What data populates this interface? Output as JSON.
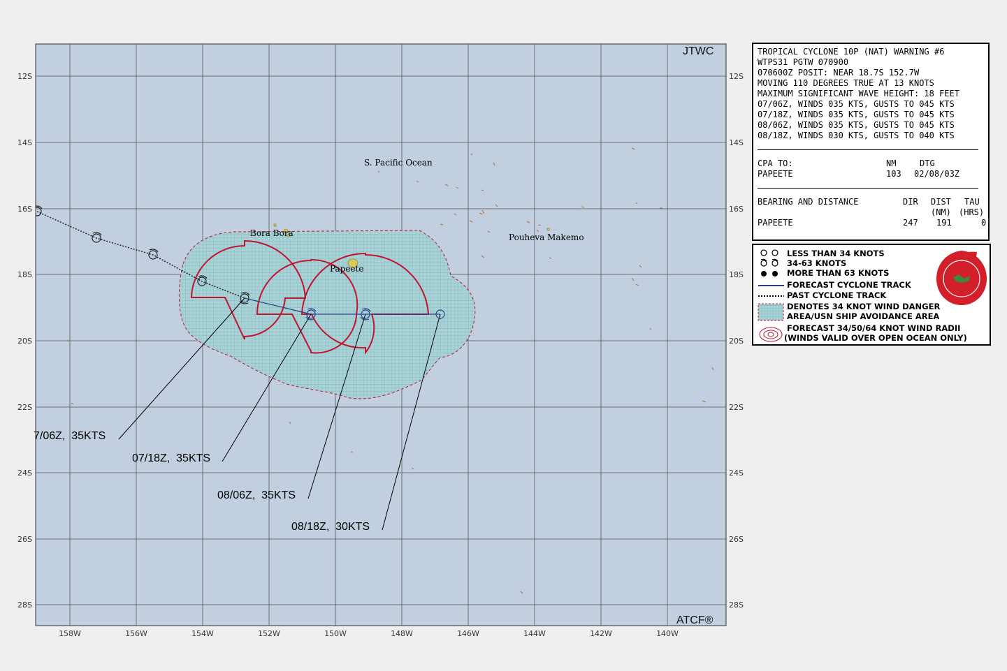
{
  "header": {
    "agency": "JTWC",
    "footer_mark": "ATCF®"
  },
  "map": {
    "lon_range": [
      -159,
      -148.6
    ],
    "lat_range": [
      -29.6,
      -11.1
    ],
    "lon_ticks": [
      "158W",
      "156W",
      "154W",
      "152W",
      "150W",
      "148W",
      "146W",
      "144W",
      "142W",
      "140W"
    ],
    "lat_ticks": [
      "12S",
      "14S",
      "16S",
      "18S",
      "20S",
      "22S",
      "24S",
      "26S",
      "28S"
    ],
    "places": [
      {
        "name": "S. Pacific Ocean"
      },
      {
        "name": "Bora Bora"
      },
      {
        "name": "Papeete"
      },
      {
        "name": "Pouheva Makemo"
      }
    ],
    "forecast_tags": [
      {
        "text": "7/06Z,  35KTS"
      },
      {
        "text": "07/18Z,  35KTS"
      },
      {
        "text": "08/06Z,  35KTS"
      },
      {
        "text": "08/18Z,  30KTS"
      }
    ]
  },
  "warning": {
    "lines": [
      "TROPICAL CYCLONE 10P (NAT) WARNING #6",
      "WTPS31 PGTW 070900",
      "070600Z POSIT: NEAR 18.7S 152.7W",
      "MOVING 110 DEGREES TRUE AT 13 KNOTS",
      "MAXIMUM SIGNIFICANT WAVE HEIGHT: 18 FEET",
      "07/06Z, WINDS 035 KTS, GUSTS TO 045 KTS",
      "07/18Z, WINDS 035 KTS, GUSTS TO 045 KTS",
      "08/06Z, WINDS 035 KTS, GUSTS TO 045 KTS",
      "08/18Z, WINDS 030 KTS, GUSTS TO 040 KTS"
    ],
    "cpa_label": "CPA TO:",
    "cpa_nm_header": "NM",
    "cpa_dtg_header": "DTG",
    "cpa_place": "PAPEETE",
    "cpa_nm": "103",
    "cpa_dtg": "02/08/03Z",
    "bd_label": "BEARING AND DISTANCE",
    "bd_dir_header": "DIR",
    "bd_dist_header": "DIST",
    "bd_tau_header": "TAU",
    "bd_nm_header": "(NM)",
    "bd_hrs_header": "(HRS)",
    "bd_place": "PAPEETE",
    "bd_dir": "247",
    "bd_dist": "191",
    "bd_tau": "0"
  },
  "legend": {
    "items": [
      "LESS THAN 34 KNOTS",
      "34-63 KNOTS",
      "MORE THAN 63 KNOTS",
      "FORECAST CYCLONE TRACK",
      "PAST CYCLONE TRACK",
      "DENOTES 34 KNOT WIND DANGER",
      "AREA/USN SHIP AVOIDANCE AREA",
      "FORECAST 34/50/64 KNOT WIND RADII",
      "(WINDS VALID OVER OPEN OCEAN ONLY)"
    ]
  },
  "colors": {
    "ocean": "#c1cfe0",
    "danger": "#99c9d0",
    "radii": "#c0142f",
    "forecast_track": "#2a3d8a",
    "land": "#d8c95a"
  }
}
